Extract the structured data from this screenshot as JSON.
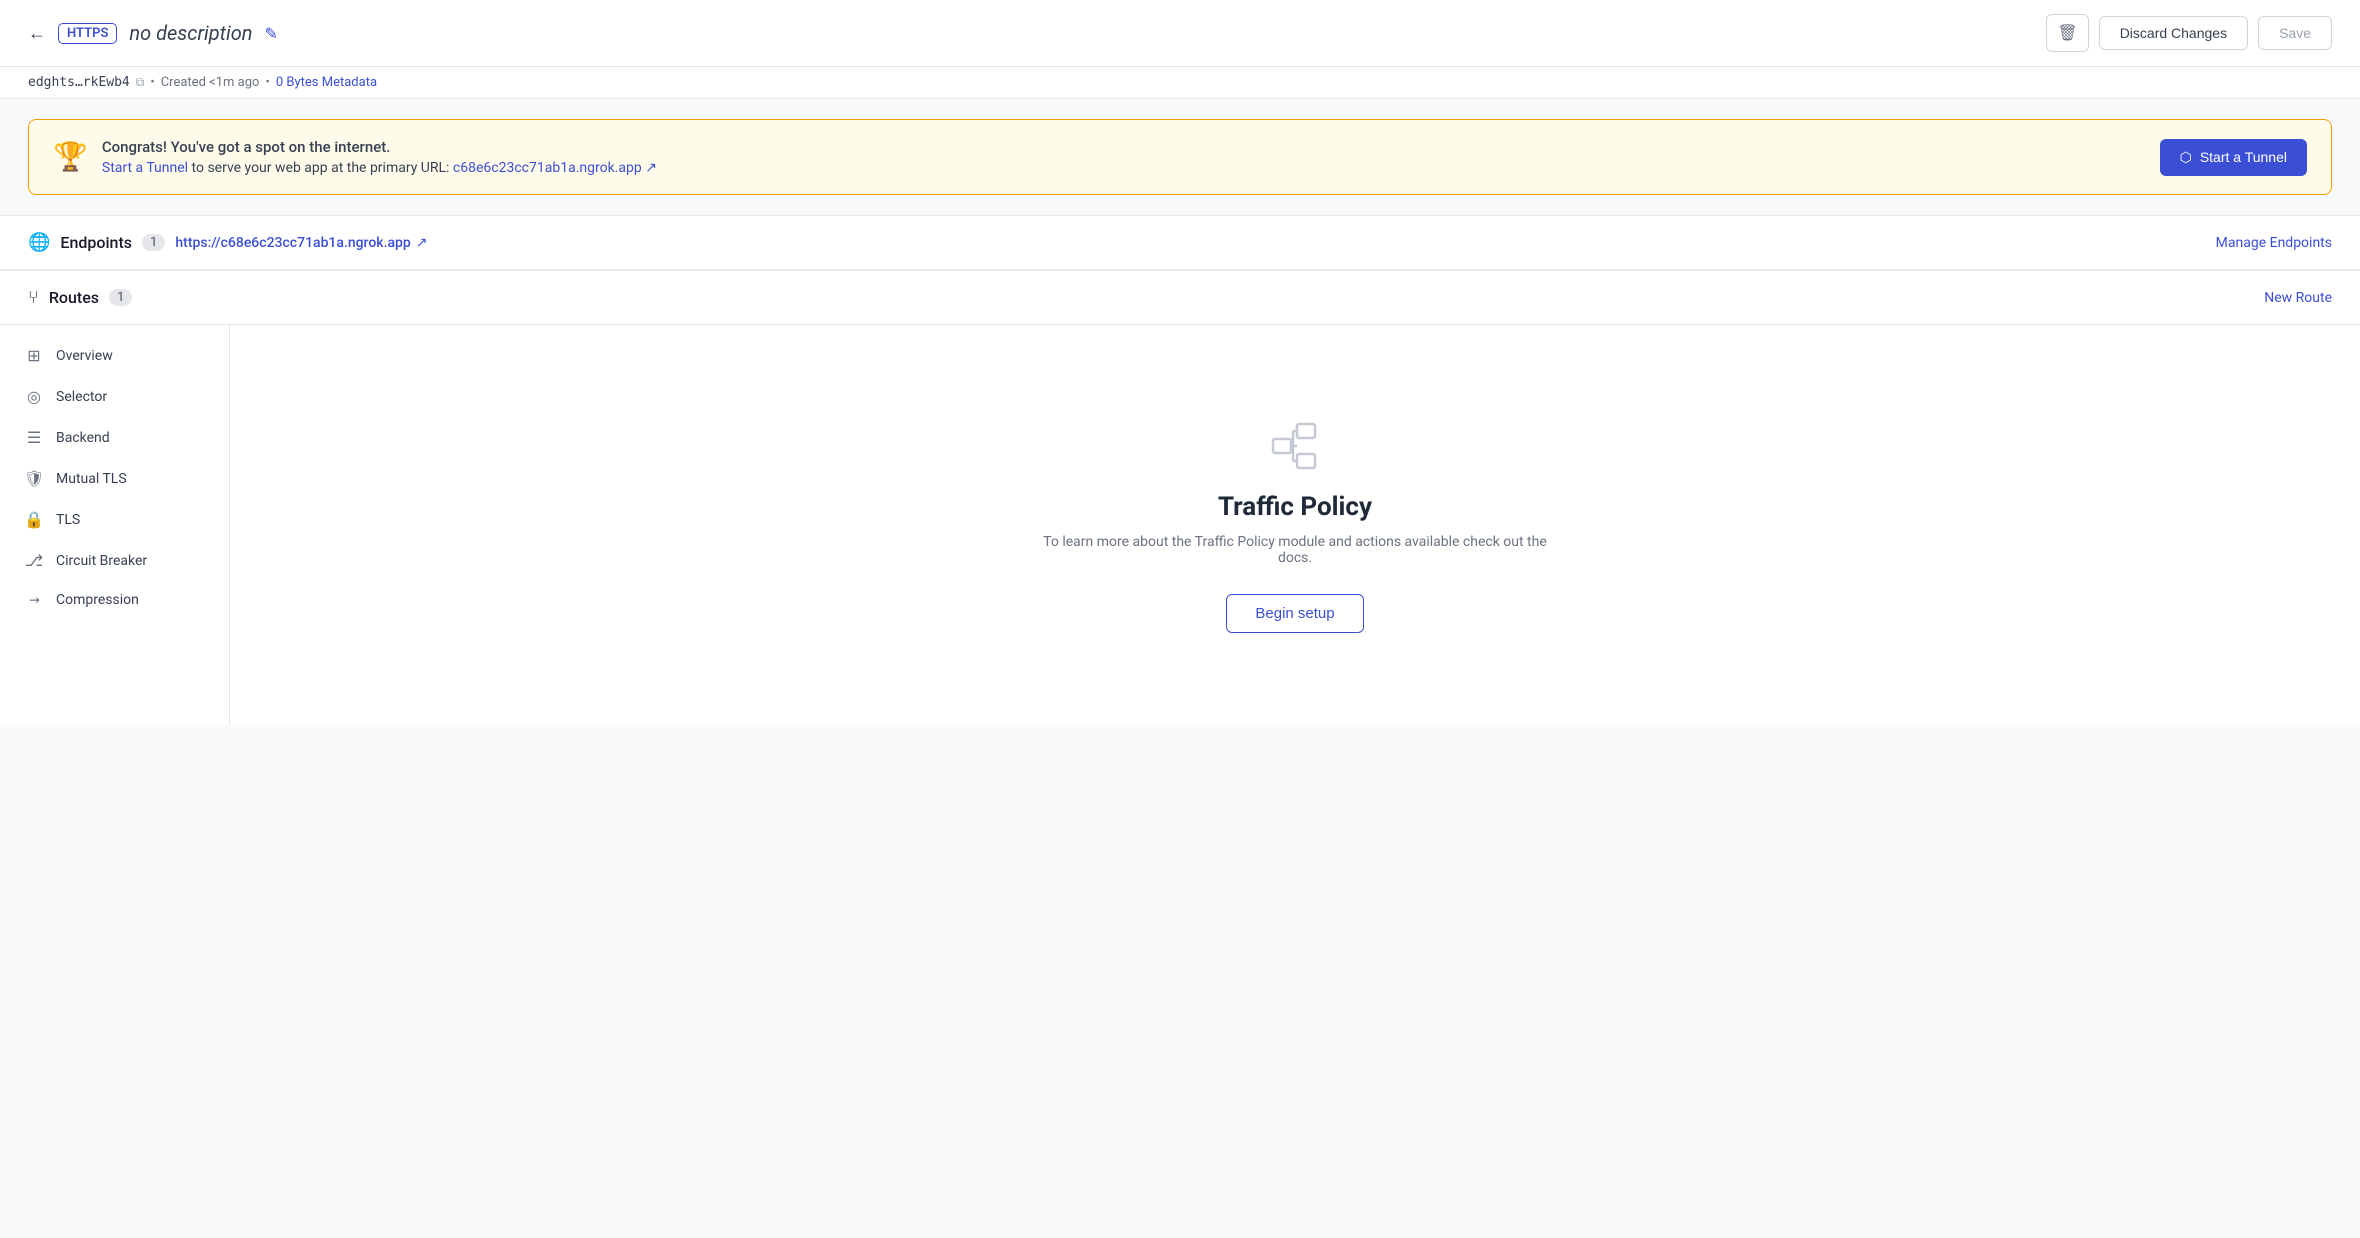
{
  "header": {
    "back_label": "←",
    "badge": "HTTPS",
    "title": "no description",
    "edit_icon": "✎",
    "delete_label": "🗑",
    "discard_label": "Discard Changes",
    "save_label": "Save"
  },
  "meta": {
    "id": "edghts…rkEwb4",
    "copy_icon": "⧉",
    "created": "Created <1m ago",
    "size": "0 Bytes",
    "metadata_label": "Metadata"
  },
  "banner": {
    "trophy_icon": "🏆",
    "main_text": "Congrats! You've got a spot on the internet.",
    "sub_text_prefix": "Start a Tunnel",
    "sub_text_middle": " to serve your web app at the primary URL: ",
    "url": "c68e6c23cc71ab1a.ngrok.app",
    "external_icon": "↗",
    "button_label": "Start a Tunnel",
    "button_icon": "⬡"
  },
  "endpoints": {
    "icon": "🌐",
    "label": "Endpoints",
    "count": "1",
    "url": "https://c68e6c23cc71ab1a.ngrok.app",
    "external_icon": "↗",
    "manage_label": "Manage Endpoints"
  },
  "routes": {
    "icon": "⑂",
    "label": "Routes",
    "count": "1",
    "new_route_label": "New Route"
  },
  "sidebar": {
    "items": [
      {
        "id": "overview",
        "icon": "⊞",
        "label": "Overview"
      },
      {
        "id": "selector",
        "icon": "◎",
        "label": "Selector"
      },
      {
        "id": "backend",
        "icon": "☰",
        "label": "Backend"
      },
      {
        "id": "mutual-tls",
        "icon": "🛡",
        "label": "Mutual TLS"
      },
      {
        "id": "tls",
        "icon": "🔒",
        "label": "TLS"
      },
      {
        "id": "circuit-breaker",
        "icon": "⎇",
        "label": "Circuit Breaker"
      },
      {
        "id": "compression",
        "icon": "↗",
        "label": "Compression"
      }
    ]
  },
  "traffic_policy": {
    "title": "Traffic Policy",
    "description": "To learn more about the Traffic Policy module and actions available check out the docs.",
    "button_label": "Begin setup"
  }
}
